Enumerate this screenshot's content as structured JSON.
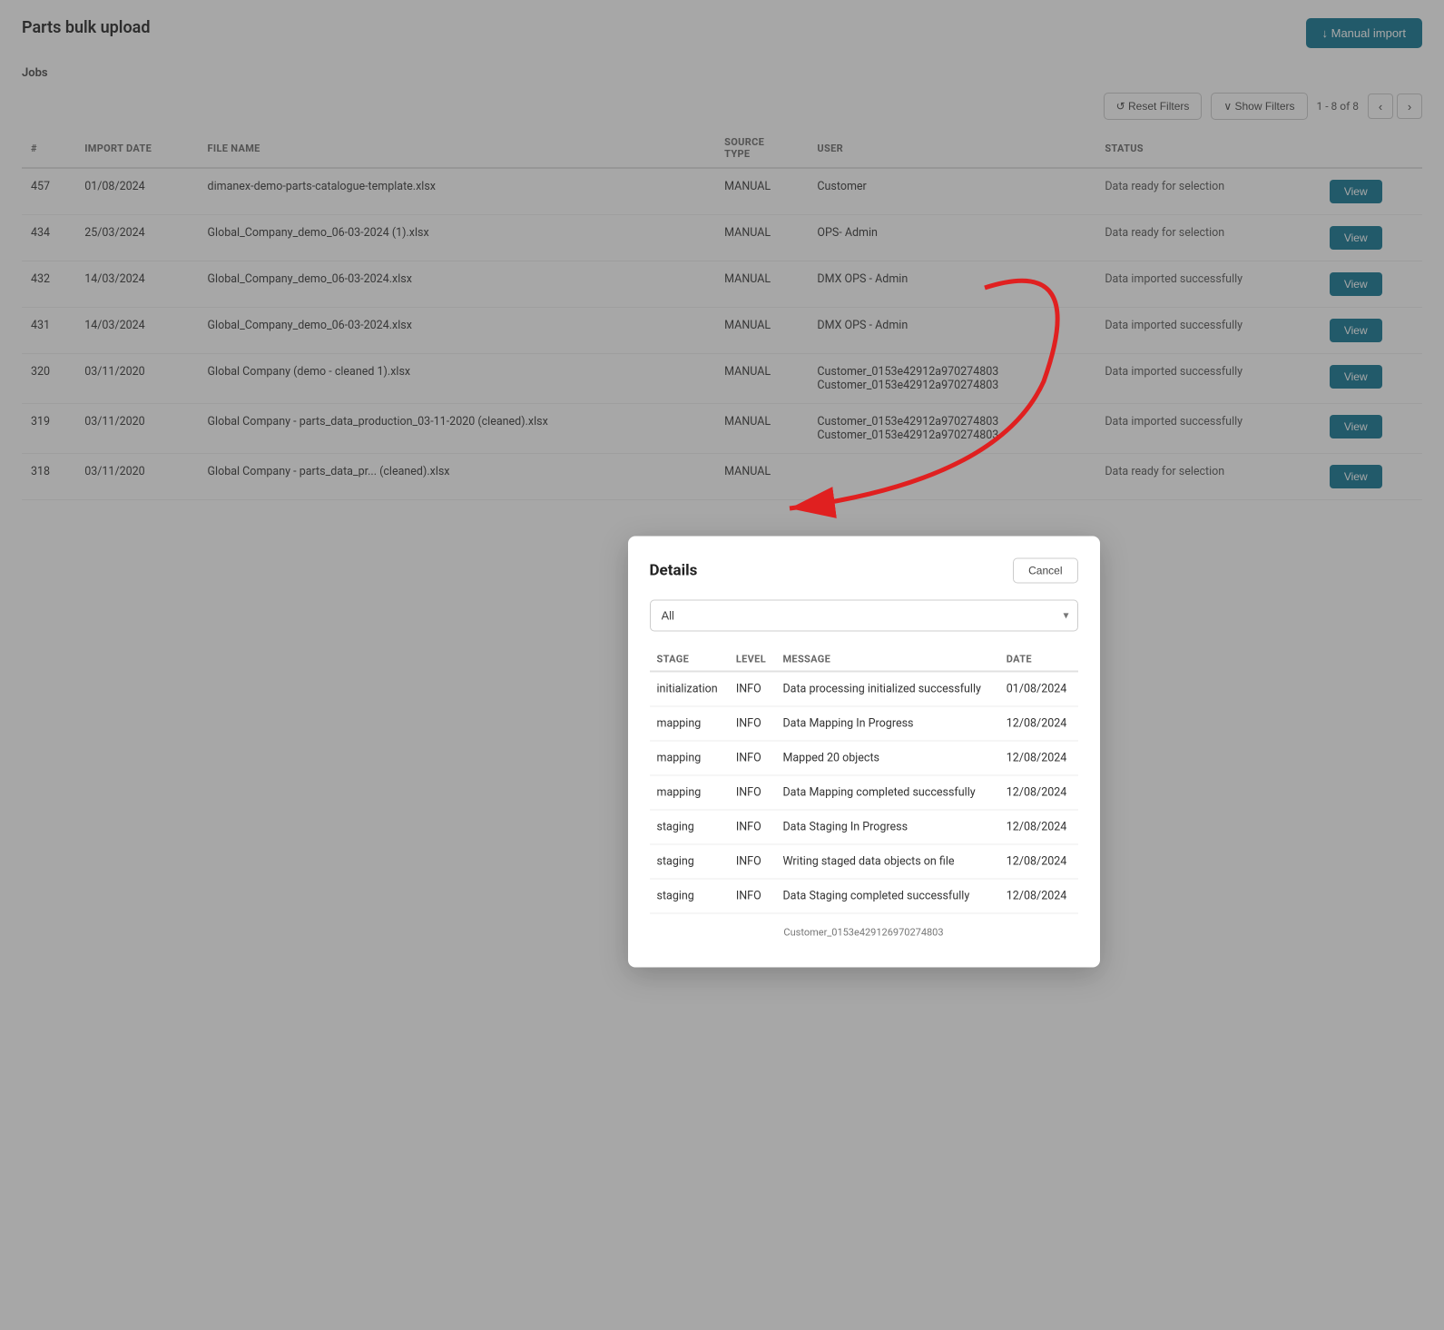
{
  "page": {
    "title": "Parts bulk upload",
    "manual_import_label": "↓ Manual import"
  },
  "toolbar": {
    "reset_filters_label": "↺ Reset Filters",
    "show_filters_label": "∨ Show Filters",
    "pagination": "1 - 8 of 8"
  },
  "table": {
    "columns": [
      "#",
      "IMPORT DATE",
      "FILE NAME",
      "SOURCE TYPE",
      "USER",
      "STATUS",
      ""
    ],
    "rows": [
      {
        "id": "457",
        "import_date": "01/08/2024",
        "file_name": "dimanex-demo-parts-catalogue-template.xlsx",
        "source_type": "MANUAL",
        "user": "Customer",
        "status": "Data ready for selection",
        "btn": "View"
      },
      {
        "id": "434",
        "import_date": "25/03/2024",
        "file_name": "Global_Company_demo_06-03-2024 (1).xlsx",
        "source_type": "MANUAL",
        "user": "OPS- Admin",
        "status": "Data ready for selection",
        "btn": "View"
      },
      {
        "id": "432",
        "import_date": "14/03/2024",
        "file_name": "Global_Company_demo_06-03-2024.xlsx",
        "source_type": "MANUAL",
        "user": "DMX OPS - Admin",
        "status": "Data imported successfully",
        "btn": "View"
      },
      {
        "id": "431",
        "import_date": "14/03/2024",
        "file_name": "Global_Company_demo_06-03-2024.xlsx",
        "source_type": "MANUAL",
        "user": "DMX OPS - Admin",
        "status": "Data imported successfully",
        "btn": "View"
      },
      {
        "id": "320",
        "import_date": "03/11/2020",
        "file_name": "Global Company (demo - cleaned 1).xlsx",
        "source_type": "MANUAL",
        "user": "Customer_0153e42912a970274803\nCustomer_0153e42912a970274803",
        "status": "Data imported successfully",
        "btn": "View"
      },
      {
        "id": "319",
        "import_date": "03/11/2020",
        "file_name": "Global Company - parts_data_production_03-11-2020 (cleaned).xlsx",
        "source_type": "MANUAL",
        "user": "Customer_0153e42912a970274803\nCustomer_0153e42912a970274803",
        "status": "Data imported successfully",
        "btn": "View"
      },
      {
        "id": "318",
        "import_date": "03/11/2020",
        "file_name": "Global Company - parts_data_pr... (cleaned).xlsx",
        "source_type": "MANUAL",
        "user": "",
        "status": "Data ready for selection",
        "btn": "View"
      }
    ]
  },
  "modal": {
    "title": "Details",
    "cancel_label": "Cancel",
    "select_value": "All",
    "columns": [
      "STAGE",
      "LEVEL",
      "MESSAGE",
      "DATE"
    ],
    "rows": [
      {
        "stage": "initialization",
        "level": "INFO",
        "message": "Data processing initialized successfully",
        "date": "01/08/2024"
      },
      {
        "stage": "mapping",
        "level": "INFO",
        "message": "Data Mapping In Progress",
        "date": "12/08/2024"
      },
      {
        "stage": "mapping",
        "level": "INFO",
        "message": "Mapped 20 objects",
        "date": "12/08/2024"
      },
      {
        "stage": "mapping",
        "level": "INFO",
        "message": "Data Mapping completed successfully",
        "date": "12/08/2024"
      },
      {
        "stage": "staging",
        "level": "INFO",
        "message": "Data Staging In Progress",
        "date": "12/08/2024"
      },
      {
        "stage": "staging",
        "level": "INFO",
        "message": "Writing staged data objects on file",
        "date": "12/08/2024"
      },
      {
        "stage": "staging",
        "level": "INFO",
        "message": "Data Staging completed successfully",
        "date": "12/08/2024"
      }
    ],
    "footer_text": "Customer_0153e429126970274803"
  },
  "section": {
    "label": "Jobs"
  },
  "icons": {
    "chevron_down": "▾",
    "reset": "↺",
    "import": "↓"
  }
}
